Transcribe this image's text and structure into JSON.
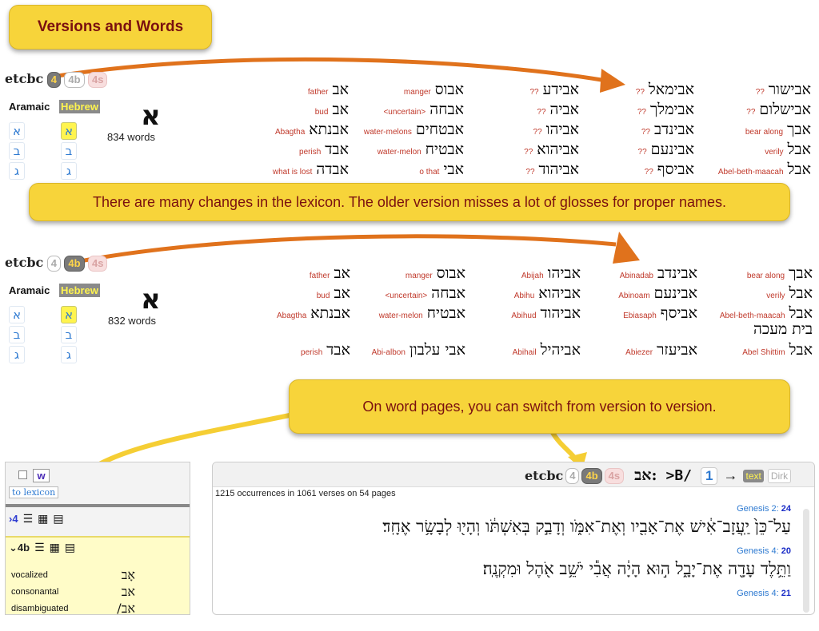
{
  "title_callout": "Versions and Words",
  "note1": "There are many changes in the lexicon. The older version misses a lot of glosses for proper names.",
  "note2": "On word pages, you can switch from version to version.",
  "colors": {
    "callout_bg": "#f7d43a",
    "callout_text": "#7a1010",
    "arrow": "#e0721c",
    "gloss": "#c0392b",
    "link": "#2e7ad1",
    "highlight": "#fff44f"
  },
  "lex1": {
    "brand": "etcbc",
    "versions": [
      "4",
      "4b",
      "4s"
    ],
    "tabs": [
      "Aramaic",
      "Hebrew"
    ],
    "letters_aram": [
      "א",
      "ב",
      "ג"
    ],
    "letters_heb": [
      "א",
      "ב",
      "ג"
    ],
    "big_letter": "א",
    "count": "834 words",
    "entries": [
      {
        "heb": "אב",
        "gloss": "father"
      },
      {
        "heb": "אב",
        "gloss": "bud"
      },
      {
        "heb": "אבנתא",
        "gloss": "Abagtha"
      },
      {
        "heb": "אבד",
        "gloss": "perish"
      },
      {
        "heb": "אבדה",
        "gloss": "what is lost"
      },
      {
        "heb": "אבוס",
        "gloss": "manger"
      },
      {
        "heb": "אבחה",
        "gloss": "<uncertain>"
      },
      {
        "heb": "אבטחים",
        "gloss": "water-melons"
      },
      {
        "heb": "אבטיח",
        "gloss": "water-melon"
      },
      {
        "heb": "אבי",
        "gloss": "o that"
      },
      {
        "heb": "אבידע",
        "gloss": "??"
      },
      {
        "heb": "אביה",
        "gloss": "??"
      },
      {
        "heb": "אביהו",
        "gloss": "??"
      },
      {
        "heb": "אביהוא",
        "gloss": "??"
      },
      {
        "heb": "אביהוד",
        "gloss": "??"
      },
      {
        "heb": "אבימאל",
        "gloss": "??"
      },
      {
        "heb": "אבימלך",
        "gloss": "??"
      },
      {
        "heb": "אבינדב",
        "gloss": "??"
      },
      {
        "heb": "אבינעם",
        "gloss": "??"
      },
      {
        "heb": "אביסף",
        "gloss": "??"
      },
      {
        "heb": "אבישור",
        "gloss": "??"
      },
      {
        "heb": "אבישלום",
        "gloss": "??"
      },
      {
        "heb": "אבך",
        "gloss": "bear along"
      },
      {
        "heb": "אבל",
        "gloss": "verily"
      },
      {
        "heb": "אבל",
        "gloss": "Abel-beth-maacah"
      }
    ]
  },
  "lex2": {
    "brand": "etcbc",
    "versions": [
      "4",
      "4b",
      "4s"
    ],
    "tabs": [
      "Aramaic",
      "Hebrew"
    ],
    "letters_aram": [
      "א",
      "ב",
      "ג"
    ],
    "letters_heb": [
      "א",
      "ב",
      "ג"
    ],
    "big_letter": "א",
    "count": "832 words",
    "entries": [
      {
        "heb": "אב",
        "gloss": "father"
      },
      {
        "heb": "אב",
        "gloss": "bud"
      },
      {
        "heb": "אבנתא",
        "gloss": "Abagtha"
      },
      {
        "heb": "אבד",
        "gloss": "perish"
      },
      {
        "heb": "אבוס",
        "gloss": "manger"
      },
      {
        "heb": "אבחה",
        "gloss": "<uncertain>"
      },
      {
        "heb": "אבטיח",
        "gloss": "water-melon"
      },
      {
        "heb": "אבי עלבון",
        "gloss": "Abi-albon"
      },
      {
        "heb": "אביהו",
        "gloss": "Abijah"
      },
      {
        "heb": "אביהוא",
        "gloss": "Abihu"
      },
      {
        "heb": "אביהוד",
        "gloss": "Abihud"
      },
      {
        "heb": "אביהיל",
        "gloss": "Abihail"
      },
      {
        "heb": "אבינדב",
        "gloss": "Abinadab"
      },
      {
        "heb": "אבינעם",
        "gloss": "Abinoam"
      },
      {
        "heb": "אביסף",
        "gloss": "Ebiasaph"
      },
      {
        "heb": "אביעזר",
        "gloss": "Abiezer"
      },
      {
        "heb": "אבך",
        "gloss": "bear along"
      },
      {
        "heb": "אבל",
        "gloss": "verily"
      },
      {
        "heb": "אבל",
        "gloss": "Abel-beth-maacah"
      },
      {
        "heb": "בית מעכה",
        "gloss": ""
      },
      {
        "heb": "אבל",
        "gloss": "Abel Shittim"
      }
    ]
  },
  "left_panel": {
    "w_button": "w",
    "to_lexicon": "to lexicon",
    "v4_label": "4",
    "v4b_label": "4b",
    "rows": [
      {
        "label": "vocalized",
        "value": "אָב"
      },
      {
        "label": "consonantal",
        "value": "אב"
      },
      {
        "label": "disambiguated",
        "value": "אב/"
      }
    ]
  },
  "word_panel": {
    "brand": "etcbc",
    "versions": [
      "4",
      "4b",
      "4s"
    ],
    "word": "אב:",
    "translit": ">B/",
    "page_num": "1",
    "arrow": "→",
    "text_btn": "text",
    "user_btn": "Dirk",
    "occurrences": "1215 occurrences in 1061 verses on 54 pages",
    "verses": [
      {
        "ref_book": "Genesis 2:",
        "ref_verse": "24",
        "text": "עַל־כֵּן֙ יַֽעֲזָב־אִ֔ישׁ אֶת־אָבִ֖יו וְאֶת־אִמֹּ֑ו וְדָבַ֣ק בְּאִשְׁתֹּ֔ו וְהָי֖וּ לְבָשָׂ֥ר אֶחָֽד׃"
      },
      {
        "ref_book": "Genesis 4:",
        "ref_verse": "20",
        "text": "וַתֵּ֥לֶד עָדָ֖ה אֶת־יָבָ֑ל ה֣וּא הָיָ֔ה אֲבִ֕י יֹשֵׁ֥ב אֹ֖הֶל וּמִקְנֶֽה׃"
      },
      {
        "ref_book": "Genesis 4:",
        "ref_verse": "21",
        "text": ""
      }
    ]
  }
}
